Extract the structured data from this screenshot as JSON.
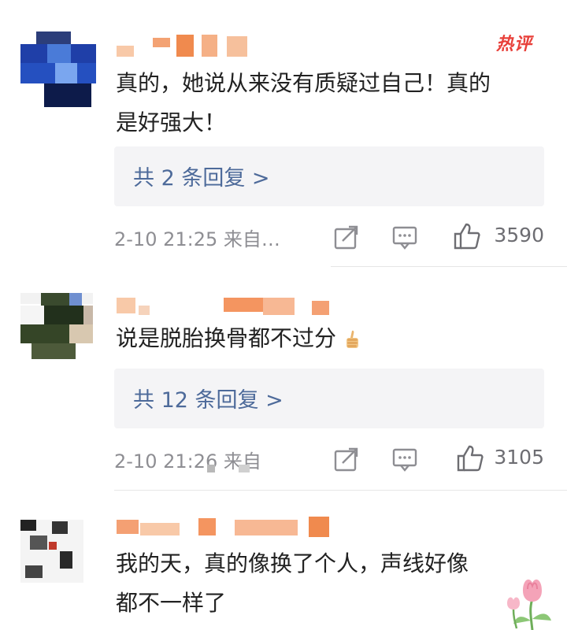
{
  "comments": [
    {
      "hot_badge": "热评",
      "text_line1": "真的，她说从来没有质疑过自己！真的",
      "text_line2": "是好强大！",
      "replies_label": "共 2 条回复 >",
      "time": "2-10 21:25 来自…",
      "likes": "3590"
    },
    {
      "text_line1": "说是脱胎换骨都不过分",
      "emoji": "thumbs-up-icon",
      "replies_label": "共 12 条回复 >",
      "time": "2-10 21:26 来自",
      "likes": "3105"
    },
    {
      "text_line1": "我的天，真的像换了个人，声线好像",
      "text_line2": "都不一样了",
      "decoration": "tulip-icon"
    }
  ],
  "colors": {
    "link": "#4d6a9a",
    "meta": "#8e8e93",
    "hot": "#e8403a",
    "reply_bg": "#f4f4f6"
  }
}
